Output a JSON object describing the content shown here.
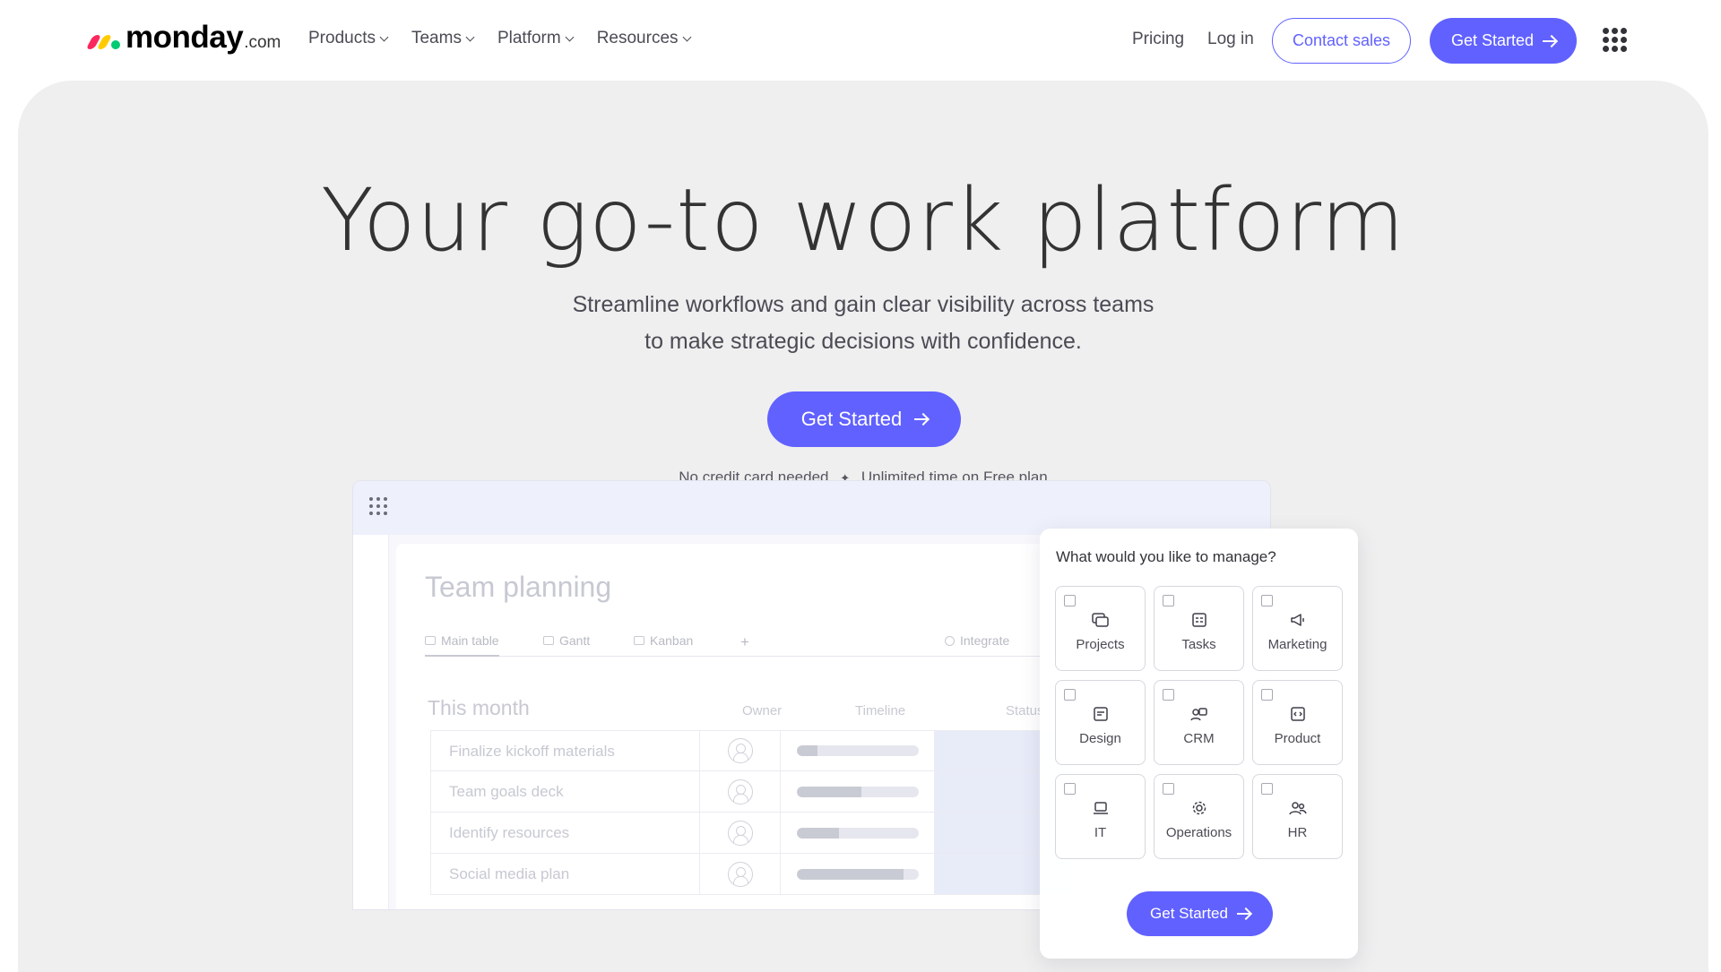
{
  "nav": {
    "logo_word": "monday",
    "logo_suffix": ".com",
    "links": [
      {
        "label": "Products"
      },
      {
        "label": "Teams"
      },
      {
        "label": "Platform"
      },
      {
        "label": "Resources"
      }
    ],
    "pricing": "Pricing",
    "login": "Log in",
    "contact": "Contact sales",
    "get_started": "Get Started"
  },
  "hero": {
    "title": "Your go-to work platform",
    "subtitle_line1": "Streamline workflows and gain clear visibility across teams",
    "subtitle_line2": "to make strategic decisions with confidence.",
    "cta": "Get Started",
    "note_left": "No credit card needed",
    "note_sep": "✦",
    "note_right": "Unlimited time on Free plan"
  },
  "board": {
    "title": "Team planning",
    "tabs": [
      "Main table",
      "Gantt",
      "Kanban",
      "+"
    ],
    "integrate": "Integrate",
    "section": "This month",
    "columns": [
      "Owner",
      "Timeline",
      "Status"
    ],
    "rows": [
      {
        "name": "Finalize kickoff materials",
        "progress": 0.17
      },
      {
        "name": "Team goals deck",
        "progress": 0.53
      },
      {
        "name": "Identify resources",
        "progress": 0.35
      },
      {
        "name": "Social media plan",
        "progress": 0.88
      }
    ]
  },
  "manage": {
    "question": "What would you like to manage?",
    "options": [
      {
        "label": "Projects",
        "icon": "projects-icon"
      },
      {
        "label": "Tasks",
        "icon": "tasks-icon"
      },
      {
        "label": "Marketing",
        "icon": "megaphone-icon"
      },
      {
        "label": "Design",
        "icon": "design-icon"
      },
      {
        "label": "CRM",
        "icon": "crm-icon"
      },
      {
        "label": "Product",
        "icon": "product-icon"
      },
      {
        "label": "IT",
        "icon": "laptop-icon"
      },
      {
        "label": "Operations",
        "icon": "gear-icon"
      },
      {
        "label": "HR",
        "icon": "people-icon"
      }
    ],
    "cta": "Get Started"
  },
  "colors": {
    "accent": "#6161ff",
    "hero_bg": "#efefef"
  }
}
